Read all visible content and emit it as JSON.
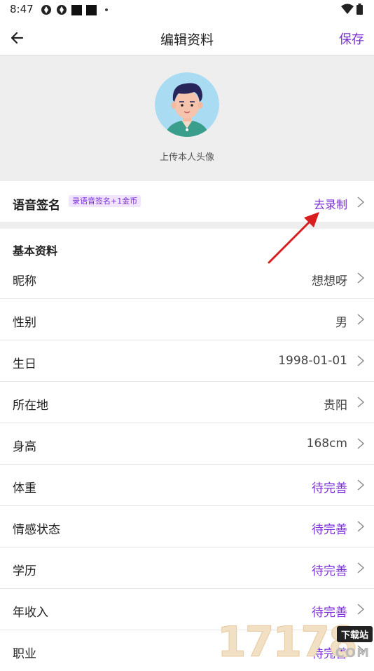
{
  "status_bar": {
    "time": "8:47"
  },
  "nav": {
    "title": "编辑资料",
    "save_label": "保存"
  },
  "avatar": {
    "caption": "上传本人头像"
  },
  "voice_signature": {
    "title": "语音签名",
    "badge": "录语音签名+1金币",
    "action": "去录制"
  },
  "basic_info": {
    "section_title": "基本资料",
    "rows": [
      {
        "label": "昵称",
        "value": "想想呀",
        "pending": false
      },
      {
        "label": "性别",
        "value": "男",
        "pending": false
      },
      {
        "label": "生日",
        "value": "1998-01-01",
        "pending": false
      },
      {
        "label": "所在地",
        "value": "贵阳",
        "pending": false
      },
      {
        "label": "身高",
        "value": "168cm",
        "pending": false
      },
      {
        "label": "体重",
        "value": "待完善",
        "pending": true
      },
      {
        "label": "情感状态",
        "value": "待完善",
        "pending": true
      },
      {
        "label": "学历",
        "value": "待完善",
        "pending": true
      },
      {
        "label": "年收入",
        "value": "待完善",
        "pending": true
      },
      {
        "label": "职业",
        "value": "待完善",
        "pending": true
      }
    ]
  },
  "colors": {
    "accent": "#7b2fd6",
    "annotation_arrow": "#d81e1e"
  },
  "icons": [
    "back-arrow-icon",
    "chevron-right-icon",
    "wifi-icon",
    "battery-icon"
  ],
  "watermark": {
    "digits": "17178",
    "badge": "下载站",
    "domain": ".COM"
  }
}
